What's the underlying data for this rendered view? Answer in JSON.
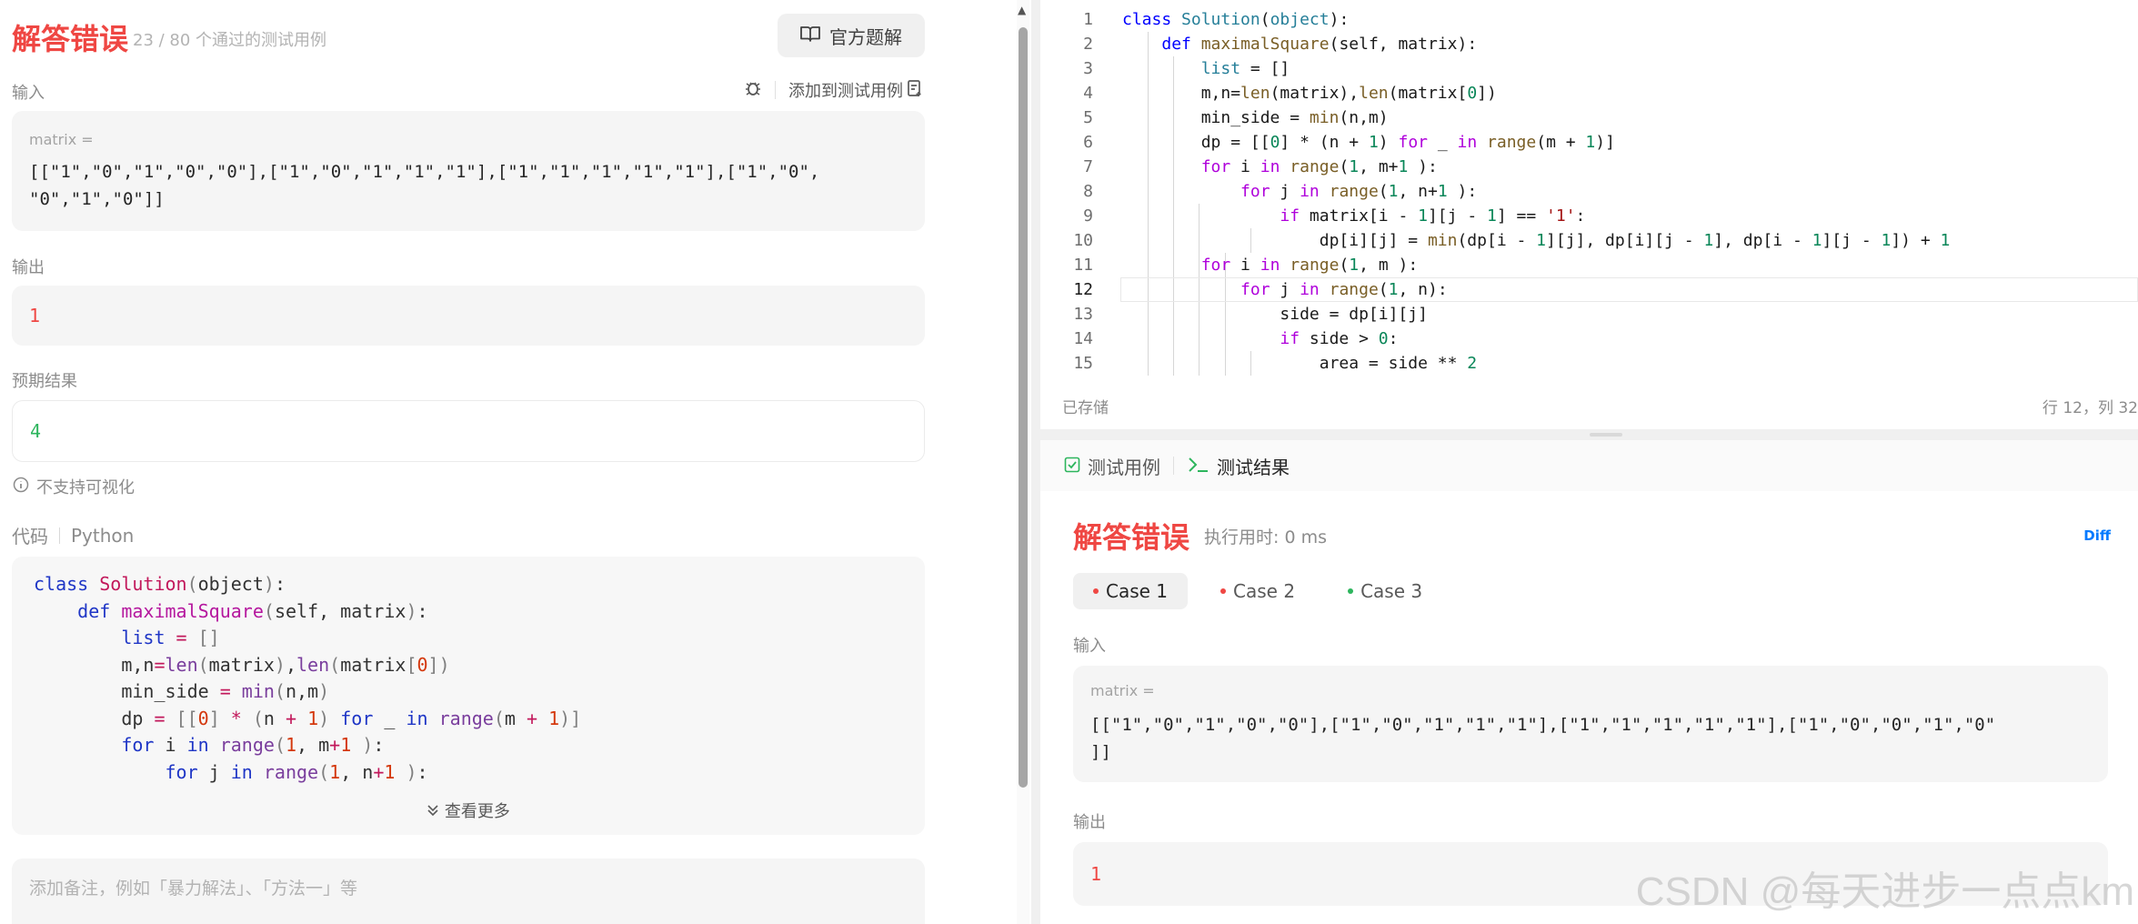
{
  "left": {
    "status_title": "解答错误",
    "pass_count": "23 / 80 个通过的测试用例",
    "official_solution": "官方题解",
    "input_label": "输入",
    "add_testcase": "添加到测试用例",
    "input_var": "matrix =",
    "input_line1": "[[\"1\",\"0\",\"1\",\"0\",\"0\"],[\"1\",\"0\",\"1\",\"1\",\"1\"],[\"1\",\"1\",\"1\",\"1\",\"1\"],[\"1\",\"0\",",
    "input_line2": "\"0\",\"1\",\"0\"]]",
    "output_label": "输出",
    "output_value": "1",
    "expected_label": "预期结果",
    "expected_value": "4",
    "no_visual": "不支持可视化",
    "code_label": "代码",
    "code_lang": "Python",
    "view_more": "查看更多",
    "note_placeholder": "添加备注，例如「暴力解法」、「方法一」等"
  },
  "editor": {
    "line_numbers": [
      "1",
      "2",
      "3",
      "4",
      "5",
      "6",
      "7",
      "8",
      "9",
      "10",
      "11",
      "12",
      "13",
      "14",
      "15"
    ],
    "saved": "已存储",
    "cursor": "行 12，列 32"
  },
  "result": {
    "tab_testcase": "测试用例",
    "tab_result": "测试结果",
    "title": "解答错误",
    "runtime": "执行用时: 0 ms",
    "diff": "Diff",
    "cases": [
      "Case 1",
      "Case 2",
      "Case 3"
    ],
    "input_label": "输入",
    "input_var": "matrix =",
    "input_line1": "[[\"1\",\"0\",\"1\",\"0\",\"0\"],[\"1\",\"0\",\"1\",\"1\",\"1\"],[\"1\",\"1\",\"1\",\"1\",\"1\"],[\"1\",\"0\",\"0\",\"1\",\"0\"",
    "input_line2": "]]",
    "output_label": "输出",
    "output_value": "1"
  },
  "watermark": "CSDN @每天进步一点点km",
  "colors": {
    "error": "#ef4743",
    "success": "#2db55d",
    "link": "#007aff"
  }
}
